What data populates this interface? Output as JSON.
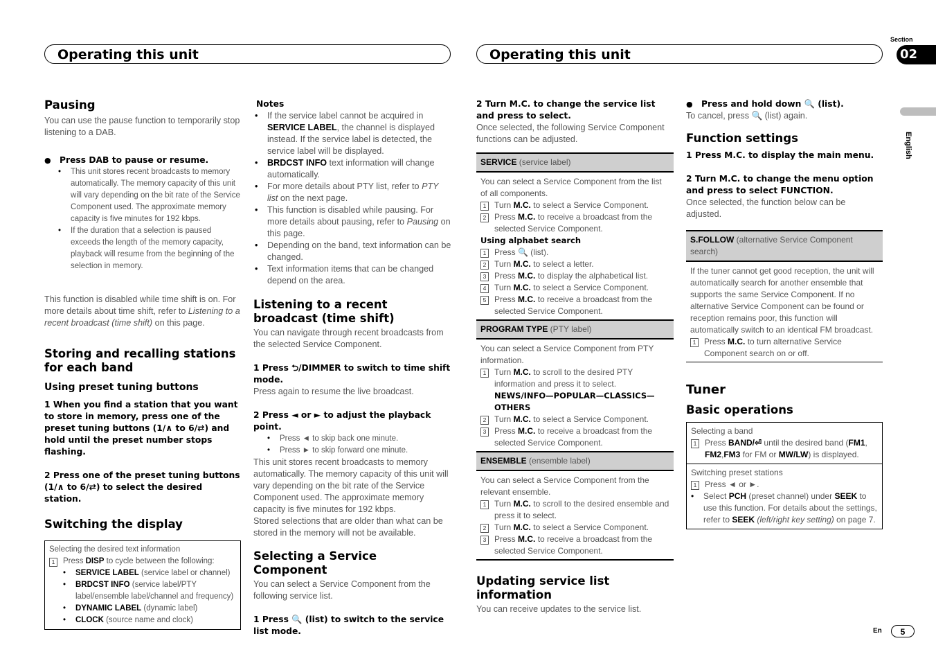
{
  "header": {
    "left_title": "Operating this unit",
    "right_title": "Operating this unit",
    "section_label": "Section",
    "section_num": "02",
    "language_tab": "English"
  },
  "footer": {
    "lang": "En",
    "page": "5"
  },
  "col1": {
    "pausing_title": "Pausing",
    "pausing_intro": "You can use the pause function to temporarily stop listening to a DAB.",
    "pausing_step": "Press DAB to pause or resume.",
    "pausing_bullets": [
      "This unit stores recent broadcasts to memory automatically. The memory capacity of this unit will vary depending on the bit rate of the Service Component used. The approximate memory capacity is five minutes for 192 kbps.",
      "If the duration that a selection is paused exceeds the length of the memory capacity, playback will resume from the beginning of the selection in memory."
    ],
    "pausing_note_a": "This function is disabled while time shift is on. For more details about time shift, refer to ",
    "pausing_note_link": "Listening to a recent broadcast (time shift)",
    "pausing_note_b": " on this page.",
    "storing_title": "Storing and recalling stations for each band",
    "preset_title": "Using preset tuning buttons",
    "preset_step1": "1   When you find a station that you want to store in memory, press one of the preset tuning buttons (1/∧ to 6/⇄) and hold until the preset number stops flashing.",
    "preset_step2": "2   Press one of the preset tuning buttons (1/∧ to 6/⇄) to select the desired station.",
    "display_title": "Switching the display",
    "display_box_title": "Selecting the desired text information",
    "display_step_pre": "Press ",
    "display_step_key": "DISP",
    "display_step_post": " to cycle between the following:",
    "display_items": [
      {
        "key": "SERVICE LABEL",
        "desc": " (service label or channel)"
      },
      {
        "key": "BRDCST INFO",
        "desc": " (service label/PTY label/ensemble label/channel and frequency)"
      },
      {
        "key": "DYNAMIC LABEL",
        "desc": " (dynamic label)"
      },
      {
        "key": "CLOCK",
        "desc": " (source name and clock)"
      }
    ]
  },
  "col2": {
    "notes_title": "Notes",
    "notes": [
      {
        "pre": "If the service label cannot be acquired in ",
        "key": "SERVICE LABEL",
        "post": ", the channel is displayed instead. If the service label is detected, the service label will be displayed."
      },
      {
        "pre": "",
        "key": "BRDCST INFO",
        "post": " text information will change automatically."
      },
      {
        "pre": "For more details about PTY list, refer to ",
        "key": "",
        "post": "",
        "italic": "PTY list",
        "tail": " on the next page."
      },
      {
        "pre": "This function is disabled while pausing. For more details about pausing, refer to ",
        "key": "",
        "post": "",
        "italic": "Pausing",
        "tail": " on this page."
      },
      {
        "pre": "Depending on the band, text information can be changed.",
        "key": "",
        "post": ""
      },
      {
        "pre": "Text information items that can be changed depend on the area.",
        "key": "",
        "post": ""
      }
    ],
    "timeshift_title": "Listening to a recent broadcast (time shift)",
    "timeshift_intro": "You can navigate through recent broadcasts from the selected Service Component.",
    "timeshift_step1": "1   Press ⮌/DIMMER to switch to time shift mode.",
    "timeshift_step1_note": "Press again to resume the live broadcast.",
    "timeshift_step2": "2   Press ◄ or ► to adjust the playback point.",
    "timeshift_bullets": [
      "Press ◄ to skip back one minute.",
      "Press ► to skip forward one minute."
    ],
    "timeshift_para": "This unit stores recent broadcasts to memory automatically. The memory capacity of this unit will vary depending on the bit rate of the Service Component used. The approximate memory capacity is five minutes for 192 kbps.",
    "timeshift_para2": "Stored selections that are older than what can be stored in the memory will not be available.",
    "select_title": "Selecting a Service Component",
    "select_intro": "You can select a Service Component from the following service list.",
    "select_step1": "1   Press 🔍 (list) to switch to the service list mode."
  },
  "col3": {
    "step2": "2   Turn M.C. to change the service list and press to select.",
    "step2_note": "Once selected, the following Service Component functions can be adjusted.",
    "service_key": "SERVICE",
    "service_desc": " (service label)",
    "service_intro": "You can select a Service Component from the list of all components.",
    "service_steps": [
      {
        "n": "1",
        "pre": "Turn ",
        "key": "M.C.",
        "post": " to select a Service Component."
      },
      {
        "n": "2",
        "pre": "Press ",
        "key": "M.C.",
        "post": " to receive a broadcast from the selected Service Component."
      }
    ],
    "alpha_title": "Using alphabet search",
    "alpha_steps": [
      {
        "n": "1",
        "pre": "Press 🔍 (list).",
        "key": "",
        "post": ""
      },
      {
        "n": "2",
        "pre": "Turn ",
        "key": "M.C.",
        "post": " to select a letter."
      },
      {
        "n": "3",
        "pre": "Press ",
        "key": "M.C.",
        "post": " to display the alphabetical list."
      },
      {
        "n": "4",
        "pre": "Turn ",
        "key": "M.C.",
        "post": " to select a Service Component."
      },
      {
        "n": "5",
        "pre": "Press ",
        "key": "M.C.",
        "post": " to receive a broadcast from the selected Service Component."
      }
    ],
    "pty_key": "PROGRAM TYPE",
    "pty_desc": " (PTY label)",
    "pty_intro": "You can select a Service Component from PTY information.",
    "pty_steps": [
      {
        "n": "1",
        "pre": "Turn ",
        "key": "M.C.",
        "post": " to scroll to the desired PTY information and press it to select."
      },
      {
        "n": "2",
        "pre": "Turn ",
        "key": "M.C.",
        "post": " to select a Service Component."
      },
      {
        "n": "3",
        "pre": "Press ",
        "key": "M.C.",
        "post": " to receive a broadcast from the selected Service Component."
      }
    ],
    "pty_options": "NEWS/INFO—POPULAR—CLASSICS—OTHERS",
    "ens_key": "ENSEMBLE",
    "ens_desc": " (ensemble label)",
    "ens_intro": "You can select a Service Component from the relevant ensemble.",
    "ens_steps": [
      {
        "n": "1",
        "pre": "Turn ",
        "key": "M.C.",
        "post": " to scroll to the desired ensemble and press it to select."
      },
      {
        "n": "2",
        "pre": "Turn ",
        "key": "M.C.",
        "post": " to select a Service Component."
      },
      {
        "n": "3",
        "pre": "Press ",
        "key": "M.C.",
        "post": " to receive a broadcast from the selected Service Component."
      }
    ],
    "update_title": "Updating service list information",
    "update_intro": "You can receive updates to the service list."
  },
  "col4": {
    "hold_step": "Press and hold down 🔍 (list).",
    "hold_note": "To cancel, press 🔍 (list) again.",
    "func_title": "Function settings",
    "func_step1": "1   Press M.C. to display the main menu.",
    "func_step2": "2   Turn M.C. to change the menu option and press to select FUNCTION.",
    "func_note": "Once selected, the function below can be adjusted.",
    "sfollow_key": "S.FOLLOW",
    "sfollow_desc": " (alternative Service Component search)",
    "sfollow_text": "If the tuner cannot get good reception, the unit will automatically search for another ensemble that supports the same Service Component. If no alternative Service Component can be found or reception remains poor, this function will automatically switch to an identical FM broadcast.",
    "sfollow_step": {
      "n": "1",
      "pre": "Press ",
      "key": "M.C.",
      "post": " to turn alternative Service Component search on or off."
    },
    "tuner_title": "Tuner",
    "basic_title": "Basic operations",
    "band_title": "Selecting a band",
    "band_step_html": {
      "n": "1",
      "a": "Press ",
      "k1": "BAND/⏎",
      "b": " until the desired band (",
      "k2": "FM1",
      "c": ", ",
      "k3": "FM2",
      "d": ",",
      "k4": "FM3",
      "e": " for FM or ",
      "k5": "MW/LW",
      "f": ") is displayed."
    },
    "preset_title": "Switching preset stations",
    "preset_step": {
      "n": "1",
      "pre": "Press ◄ or ►."
    },
    "preset_bullet": {
      "a": "Select ",
      "k1": "PCH",
      "b": " (preset channel) under ",
      "k2": "SEEK",
      "c": " to use this function. For details about the settings, refer to ",
      "k3": "SEEK",
      "i": " (left/right key setting)",
      "d": " on page 7."
    }
  }
}
